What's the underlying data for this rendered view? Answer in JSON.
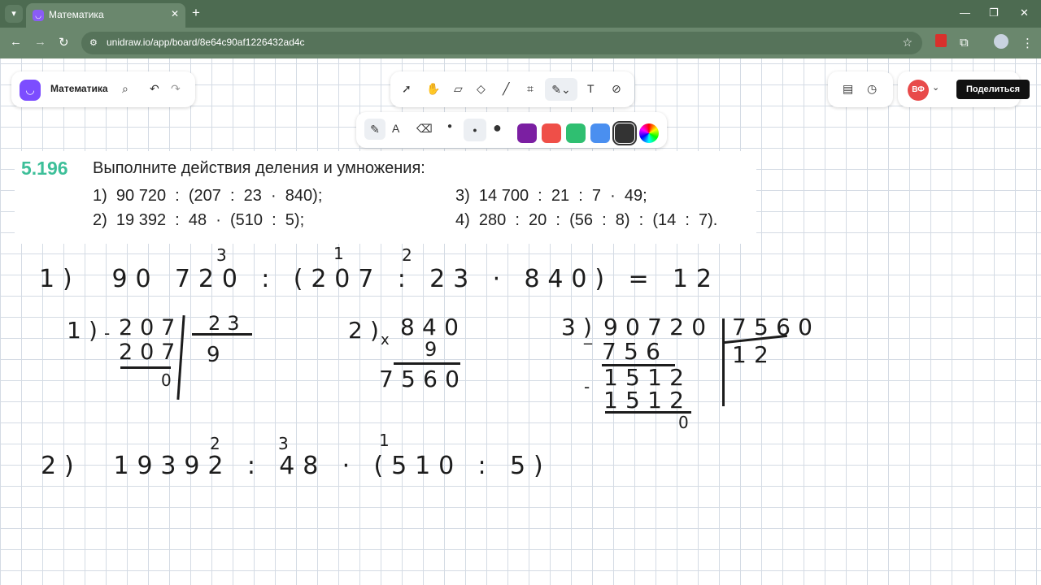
{
  "browser": {
    "tab_title": "Математика",
    "tab_close": "✕",
    "new_tab": "+",
    "url": "unidraw.io/app/board/8e64c90af1226432ad4c"
  },
  "toolbar_left": {
    "title": "Математика"
  },
  "colors": {
    "accent": "#7c4dff",
    "share_bg": "#111111",
    "task_number": "#3dbf99",
    "swatches": [
      "#7b1fa2",
      "#ef4f48",
      "#2fbf71",
      "#4a8ff0",
      "#333333"
    ]
  },
  "user": {
    "initials": "ВФ"
  },
  "share_label": "Поделиться",
  "task": {
    "number": "5.196",
    "title": "Выполните действия деления и умножения:",
    "items": [
      "1)  90 720  :  (207  :  23  ·  840);",
      "2)  19 392  :  48  ·  (510  :  5);",
      "3)  14 700  :  21  :  7  ·  49;",
      "4)  280  :  20  :  (56  :  8)  :  (14  :  7)."
    ]
  },
  "handwriting": {
    "main1": "1)  90 720 : (207 : 23 · 840) = 12",
    "order1": [
      "3",
      "1",
      "2"
    ],
    "step1_label": "1)",
    "step1_dividend": "207",
    "step1_sub": "207",
    "step1_rem": "0",
    "step1_divisor": "23",
    "step1_quot": "9",
    "step2_label": "2)",
    "step2_top": "840",
    "step2_mult": "9",
    "step2_res": "7560",
    "step3_label": "3)",
    "step3_dividend": "90720",
    "step3_divisor": "7560",
    "step3_quot": "12",
    "step3_sub1": "756",
    "step3_mid": "1512",
    "step3_sub2": "1512",
    "step3_rem": "0",
    "main2": "2)  19392 : 48 · (510 : 5)",
    "order2": [
      "2",
      "3",
      "1"
    ]
  }
}
